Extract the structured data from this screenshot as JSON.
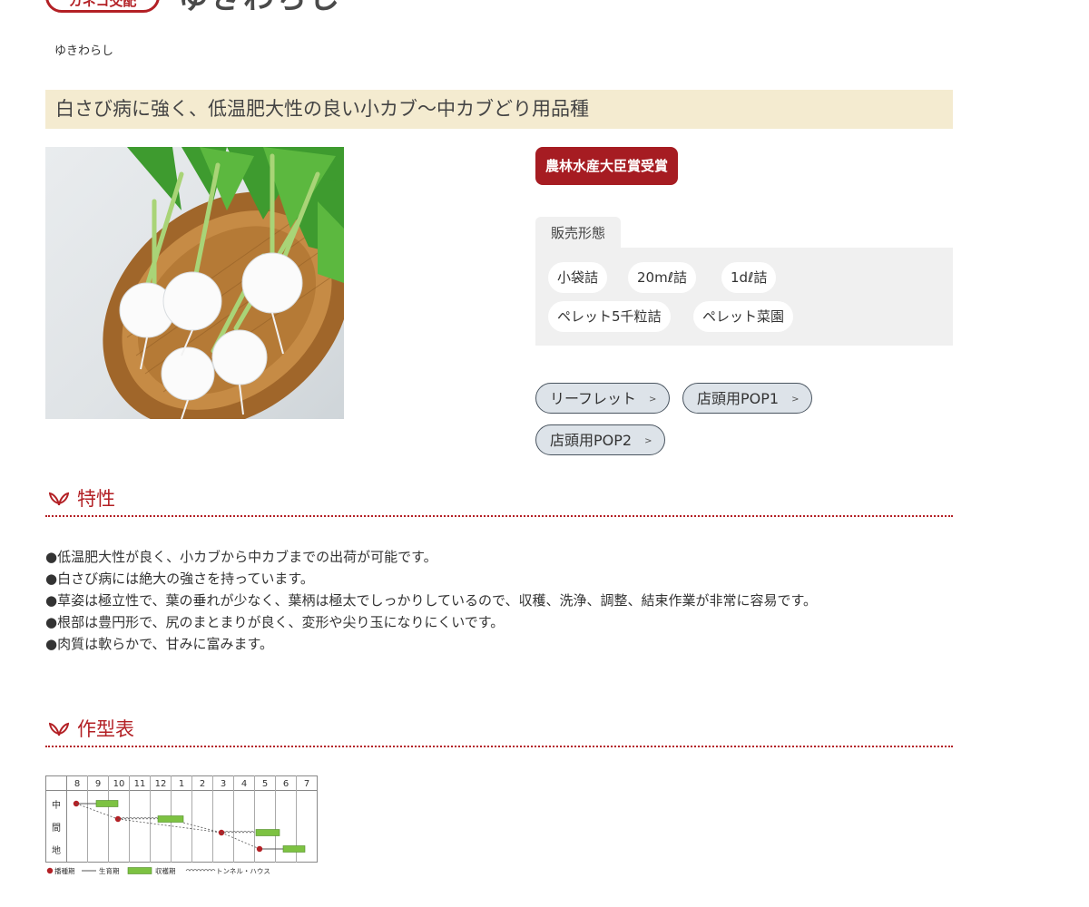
{
  "header": {
    "badge": "カネコ交配",
    "title": "ゆきわらし",
    "reading": "ゆきわらし"
  },
  "catchphrase": "白さび病に強く、低温肥大性の良い小カブ〜中カブどり用品種",
  "award": "農林水産大臣賞受賞",
  "sales": {
    "tab_label": "販売形態",
    "forms": [
      "小袋詰",
      "20mℓ詰",
      "1dℓ詰",
      "ペレット5千粒詰",
      "ペレット菜園"
    ]
  },
  "links": [
    "リーフレット",
    "店頭用POP1",
    "店頭用POP2"
  ],
  "features": {
    "title": "特性",
    "items": [
      "●低温肥大性が良く、小カブから中カブまでの出荷が可能です。",
      "●白さび病には絶大の強さを持っています。",
      "●草姿は極立性で、葉の垂れが少なく、葉柄は極太でしっかりしているので、収穫、洗浄、調整、結束作業が非常に容易です。",
      "●根部は豊円形で、尻のまとまりが良く、変形や尖り玉になりにくいです。",
      "●肉質は軟らかで、甘みに富みます。"
    ]
  },
  "schedule": {
    "title": "作型表",
    "months": [
      "8",
      "9",
      "10",
      "11",
      "12",
      "1",
      "2",
      "3",
      "4",
      "5",
      "6",
      "7"
    ],
    "region": [
      "中",
      "間",
      "地"
    ],
    "legend": {
      "sowing": "播種期",
      "growing": "生育期",
      "harvest": "収穫期",
      "tunnel": "トンネル・ハウス"
    }
  },
  "colors": {
    "accent": "#b32025",
    "award_bg": "#a61c22",
    "catch_bg": "#f4ebd0",
    "panel_bg": "#f0f0f0",
    "link_bg": "#dde3e9",
    "harvest_green": "#7dc242"
  }
}
